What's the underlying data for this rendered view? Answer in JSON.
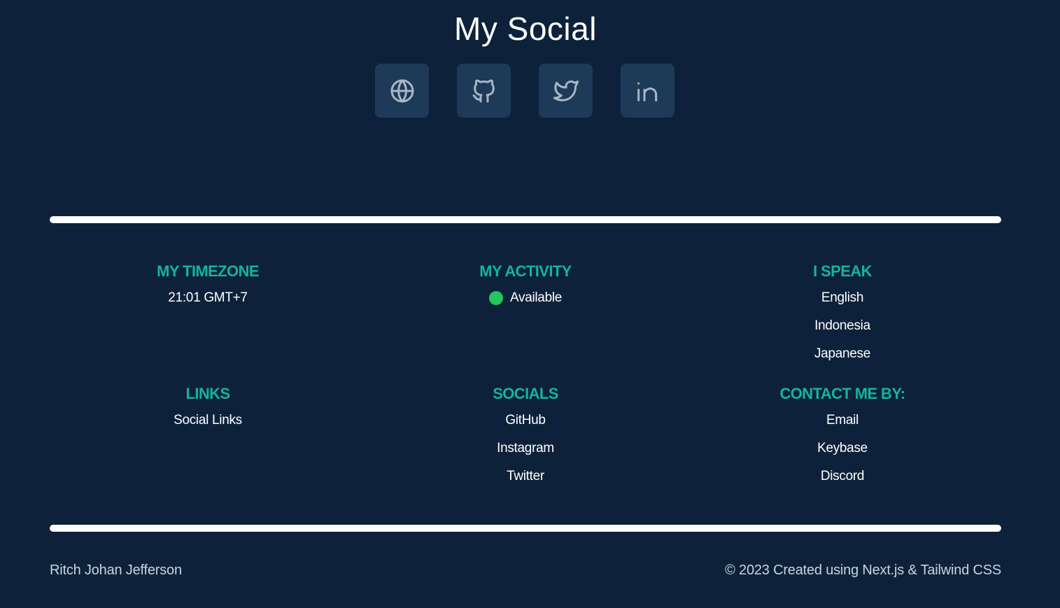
{
  "header": {
    "title": "My Social"
  },
  "social_buttons": [
    {
      "icon": "globe-icon"
    },
    {
      "icon": "github-icon"
    },
    {
      "icon": "twitter-icon"
    },
    {
      "icon": "linkedin-icon"
    }
  ],
  "footer": {
    "timezone": {
      "heading": "MY TIMEZONE",
      "value": "21:01 GMT+7"
    },
    "activity": {
      "heading": "MY ACTIVITY",
      "status": "Available",
      "status_color": "#22c55e"
    },
    "languages": {
      "heading": "I SPEAK",
      "items": [
        "English",
        "Indonesia",
        "Japanese"
      ]
    },
    "links": {
      "heading": "LINKS",
      "items": [
        "Social Links"
      ]
    },
    "socials": {
      "heading": "SOCIALS",
      "items": [
        "GitHub",
        "Instagram",
        "Twitter"
      ]
    },
    "contact": {
      "heading": "CONTACT ME BY:",
      "items": [
        "Email",
        "Keybase",
        "Discord"
      ]
    },
    "author": "Ritch Johan Jefferson",
    "copyright": "© 2023 Created using Next.js & Tailwind CSS"
  },
  "colors": {
    "background": "#0d223a",
    "accent": "#14b3a0",
    "button_bg": "#1d3a58",
    "status_dot": "#22c55e"
  }
}
